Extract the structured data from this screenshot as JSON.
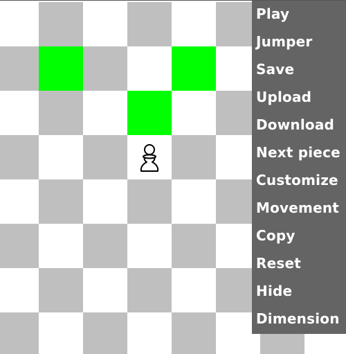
{
  "board": {
    "size": 8,
    "colors": {
      "light": "#ffffff",
      "dark": "#bfbfbf",
      "highlight": "#00ff00"
    },
    "highlighted_squares": [
      {
        "row": 1,
        "col": 1
      },
      {
        "row": 1,
        "col": 4
      },
      {
        "row": 2,
        "col": 3
      }
    ],
    "pieces": [
      {
        "row": 3,
        "col": 3,
        "type": "pawn",
        "color": "white",
        "icon": "white-pawn-icon"
      }
    ]
  },
  "menu": {
    "background": "#646464",
    "items": [
      {
        "label": "Play",
        "name": "play"
      },
      {
        "label": "Jumper",
        "name": "jumper"
      },
      {
        "label": "Save",
        "name": "save"
      },
      {
        "label": "Upload",
        "name": "upload"
      },
      {
        "label": "Download",
        "name": "download"
      },
      {
        "label": "Next piece",
        "name": "next-piece"
      },
      {
        "label": "Customize",
        "name": "customize"
      },
      {
        "label": "Movement",
        "name": "movement"
      },
      {
        "label": "Copy",
        "name": "copy"
      },
      {
        "label": "Reset",
        "name": "reset"
      },
      {
        "label": "Hide",
        "name": "hide"
      },
      {
        "label": "Dimension",
        "name": "dimension"
      }
    ]
  }
}
